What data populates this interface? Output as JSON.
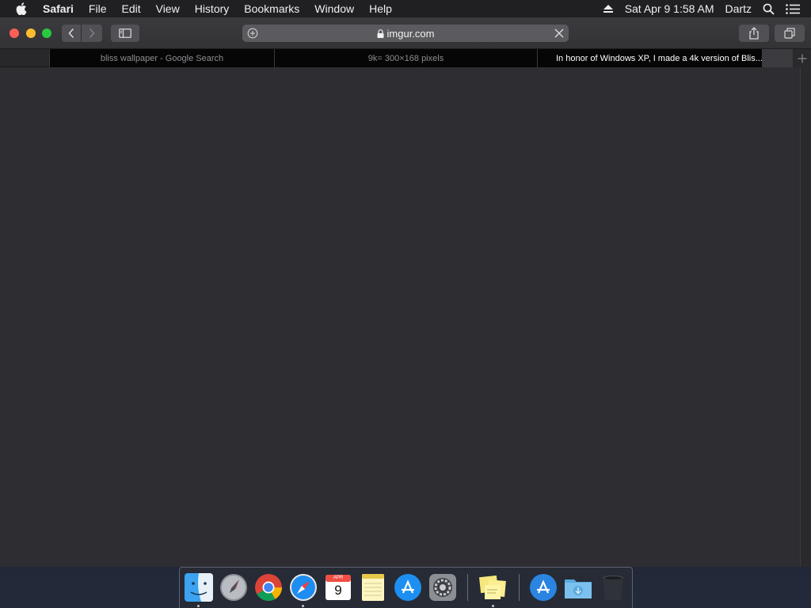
{
  "menubar": {
    "apple_icon": "apple-logo-icon",
    "app_name": "Safari",
    "menus": [
      "File",
      "Edit",
      "View",
      "History",
      "Bookmarks",
      "Window",
      "Help"
    ],
    "clock": "Sat Apr 9  1:58 AM",
    "user": "Dartz",
    "status_icons": [
      "eject-icon",
      "spotlight-search-icon",
      "notification-center-icon"
    ]
  },
  "toolbar": {
    "address": "imgur.com",
    "secure": true
  },
  "tabs": [
    {
      "title": "bliss wallpaper - Google Search",
      "active": false
    },
    {
      "title": "9k= 300×168 pixels",
      "active": false
    },
    {
      "title": "In honor of Windows XP, I made a 4k version of Blis...",
      "active": true
    }
  ],
  "dock": {
    "calendar_month": "APR",
    "calendar_day": "9",
    "items": [
      {
        "name": "Finder",
        "running": true
      },
      {
        "name": "Launchpad",
        "running": false
      },
      {
        "name": "Google Chrome",
        "running": false
      },
      {
        "name": "Safari",
        "running": true
      },
      {
        "name": "Calendar",
        "running": false
      },
      {
        "name": "Notes",
        "running": false
      },
      {
        "name": "App Store",
        "running": false
      },
      {
        "name": "System Preferences",
        "running": false
      },
      {
        "name": "Stickies",
        "running": true
      },
      {
        "name": "Applications",
        "running": false
      },
      {
        "name": "Downloads",
        "running": false
      },
      {
        "name": "Trash",
        "running": false
      }
    ]
  },
  "colors": {
    "close": "#fd5f57",
    "minimize": "#febc2e",
    "maximize": "#28c840",
    "content_bg": "#2e2e32"
  }
}
